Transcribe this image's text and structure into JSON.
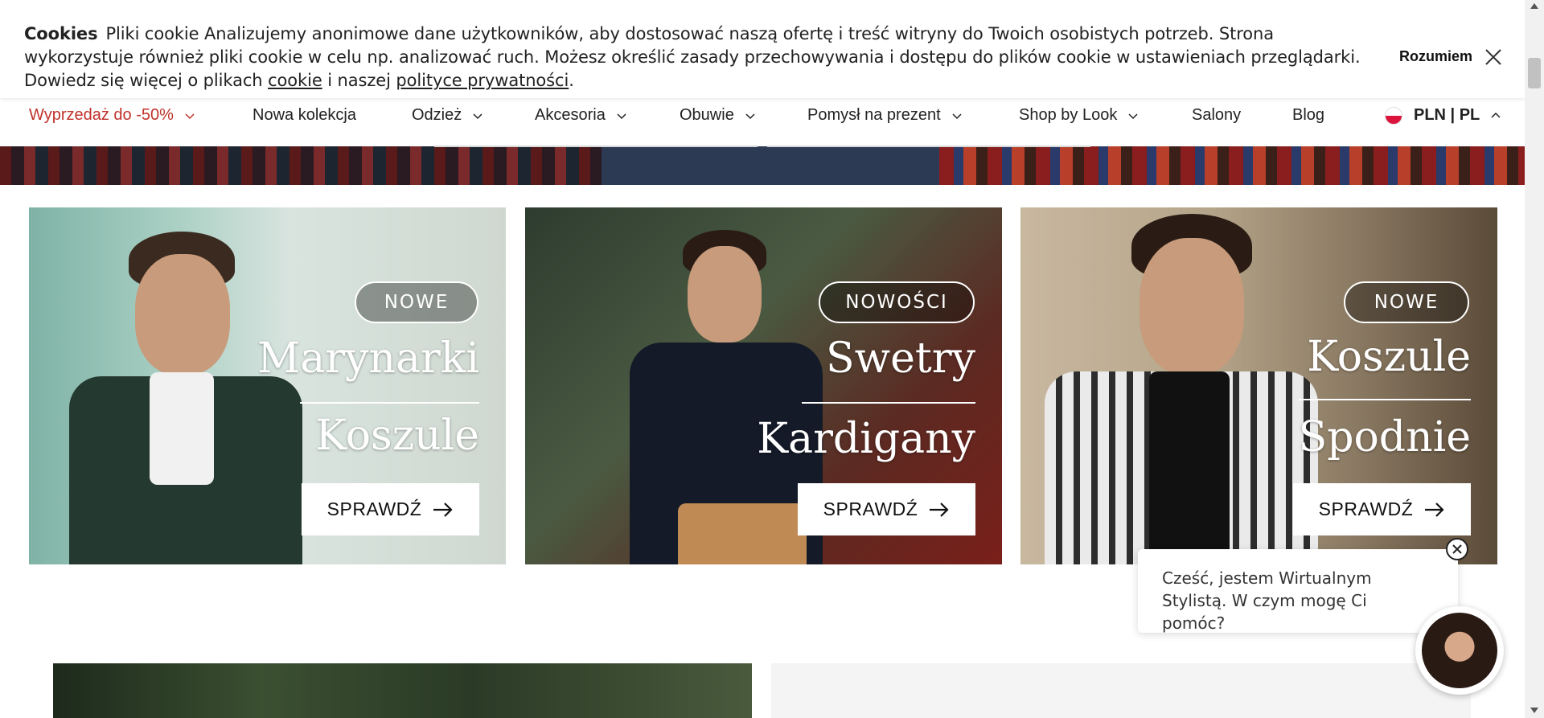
{
  "cookie": {
    "title": "Cookies",
    "text_before_link": "Pliki cookie Analizujemy anonimowe dane użytkowników, aby dostosować naszą ofertę i treść witryny do Twoich osobistych potrzeb. Strona wykorzystuje również pliki cookie w celu np. analizować ruch. Możesz określić zasady przechowywania i dostępu do plików cookie w ustawieniach przeglądarki. Dowiedz się więcej o plikach ",
    "cookie_link": "cookie",
    "middle_text": " i naszej ",
    "privacy_link": "polityce prywatności",
    "end_text": ".",
    "accept_label": "Rozumiem",
    "close_icon": "close-icon"
  },
  "nav": {
    "items": [
      {
        "label": "Wyprzedaż do -50%",
        "has_dropdown": true,
        "sale": true
      },
      {
        "label": "Nowa kolekcja",
        "has_dropdown": false
      },
      {
        "label": "Odzież",
        "has_dropdown": true
      },
      {
        "label": "Akcesoria",
        "has_dropdown": true
      },
      {
        "label": "Obuwie",
        "has_dropdown": true
      },
      {
        "label": "Pomysł na prezent",
        "has_dropdown": true
      },
      {
        "label": "Shop by Look",
        "has_dropdown": true
      },
      {
        "label": "Salony",
        "has_dropdown": false
      },
      {
        "label": "Blog",
        "has_dropdown": false
      }
    ],
    "currency": "PLN | PL"
  },
  "cards": [
    {
      "badge": "NOWE",
      "line1": "Marynarki",
      "line2": "Koszule",
      "cta": "SPRAWDŹ"
    },
    {
      "badge": "NOWOŚCI",
      "line1": "Swetry",
      "line2": "Kardigany",
      "cta": "SPRAWDŹ"
    },
    {
      "badge": "NOWE",
      "line1": "Koszule",
      "line2": "Spodnie",
      "cta": "SPRAWDŹ"
    }
  ],
  "chat": {
    "message": "Cześć, jestem Wirtualnym Stylistą. W czym mogę Ci pomóc?"
  },
  "colors": {
    "sale": "#c0322b",
    "text": "#222222"
  }
}
